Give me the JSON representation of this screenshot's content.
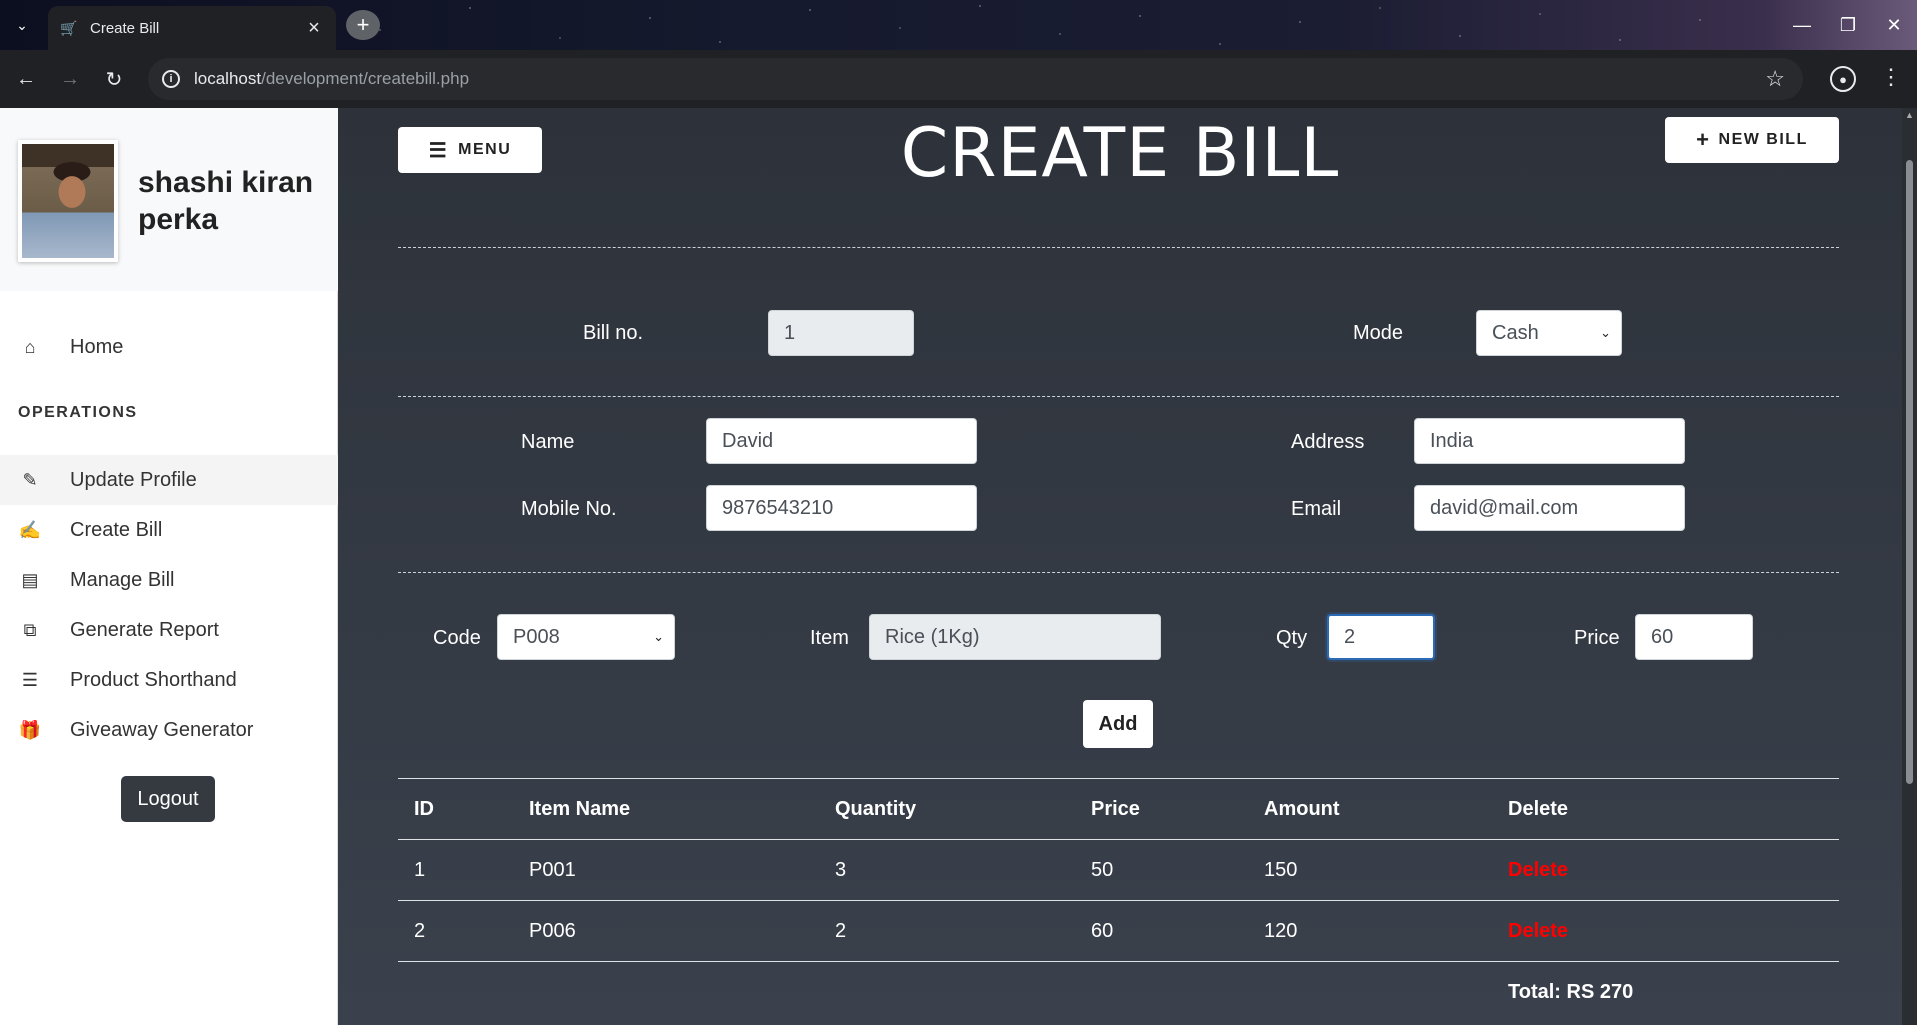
{
  "browser": {
    "tab_title": "Create Bill",
    "url_host": "localhost",
    "url_path": "/development/createbill.php"
  },
  "sidebar": {
    "user_name": "shashi kiran perka",
    "home_label": "Home",
    "section_label": "OPERATIONS",
    "items": [
      {
        "label": "Update Profile",
        "icon": "user-edit-icon"
      },
      {
        "label": "Create Bill",
        "icon": "edit-icon"
      },
      {
        "label": "Manage Bill",
        "icon": "bar-chart-icon"
      },
      {
        "label": "Generate Report",
        "icon": "clone-icon"
      },
      {
        "label": "Product Shorthand",
        "icon": "list-icon"
      },
      {
        "label": "Giveaway Generator",
        "icon": "gift-icon"
      }
    ],
    "logout_label": "Logout"
  },
  "header": {
    "menu_label": "MENU",
    "title": "CREATE BILL",
    "new_bill_label": "NEW BILL"
  },
  "bill": {
    "bill_no_label": "Bill no.",
    "bill_no_value": "1",
    "mode_label": "Mode",
    "mode_value": "Cash"
  },
  "customer": {
    "name_label": "Name",
    "name_value": "David",
    "address_label": "Address",
    "address_value": "India",
    "mobile_label": "Mobile No.",
    "mobile_value": "9876543210",
    "email_label": "Email",
    "email_value": "david@mail.com"
  },
  "item_entry": {
    "code_label": "Code",
    "code_value": "P008",
    "item_label": "Item",
    "item_value": "Rice (1Kg)",
    "qty_label": "Qty",
    "qty_value": "2",
    "price_label": "Price",
    "price_value": "60",
    "add_label": "Add"
  },
  "table": {
    "headers": [
      "ID",
      "Item Name",
      "Quantity",
      "Price",
      "Amount",
      "Delete"
    ],
    "rows": [
      {
        "id": "1",
        "item": "P001",
        "qty": "3",
        "price": "50",
        "amount": "150",
        "action": "Delete"
      },
      {
        "id": "2",
        "item": "P006",
        "qty": "2",
        "price": "60",
        "amount": "120",
        "action": "Delete"
      }
    ],
    "total": "Total: RS 270"
  },
  "colors": {
    "accent_delete": "#ff0000",
    "main_bg": "#2d323a",
    "focus_border": "#2c6ab5"
  }
}
